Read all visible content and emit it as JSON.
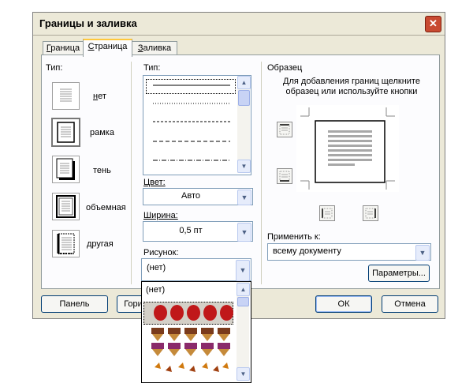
{
  "window": {
    "title": "Границы и заливка"
  },
  "tabs": [
    {
      "label": "Граница",
      "accel": "Г",
      "rest": "раница"
    },
    {
      "label": "Страница",
      "accel": "С",
      "rest": "траница"
    },
    {
      "label": "Заливка",
      "accel": "З",
      "rest": "аливка"
    }
  ],
  "type_section": {
    "label": "Тип:",
    "items": [
      {
        "label": "нет",
        "accel": "н",
        "rest": "ет",
        "icon": "no-border-icon"
      },
      {
        "label": "рамка",
        "accel": "",
        "rest": "рамка",
        "icon": "box-border-icon"
      },
      {
        "label": "тень",
        "accel": "",
        "rest": "тень",
        "icon": "shadow-border-icon"
      },
      {
        "label": "объемная",
        "accel": "",
        "rest": "объемная",
        "icon": "3d-border-icon"
      },
      {
        "label": "другая",
        "accel": "",
        "rest": "другая",
        "icon": "custom-border-icon"
      }
    ]
  },
  "style_section": {
    "label": "Тип:",
    "styles": [
      "solid",
      "dotted",
      "dashed-small",
      "dashed",
      "dash-dot"
    ],
    "color_label": "Цвет:",
    "color_value": "Авто",
    "width_label": "Ширина:",
    "width_value": "0,5 пт",
    "art_label": "Рисунок:",
    "art_value": "(нет)"
  },
  "art_dropdown": {
    "items": [
      "(нет)",
      "apples",
      "ice-cream-cones",
      "autumn-leaves"
    ]
  },
  "preview_section": {
    "label": "Образец",
    "hint": "Для добавления границ щелкните образец или используйте кнопки",
    "apply_label": "Применить к:",
    "apply_value": "всему документу",
    "options_button": "Параметры..."
  },
  "footer": {
    "panel_button": "Панель",
    "horizontal_button": "Гори",
    "ok_button": "ОК",
    "cancel_button": "Отмена"
  },
  "colors": {
    "dialog_bg": "#ECE9D8",
    "panel_bg": "#FCFCFE",
    "tab_highlight": "#FFC83C",
    "close_red": "#C84A31"
  }
}
